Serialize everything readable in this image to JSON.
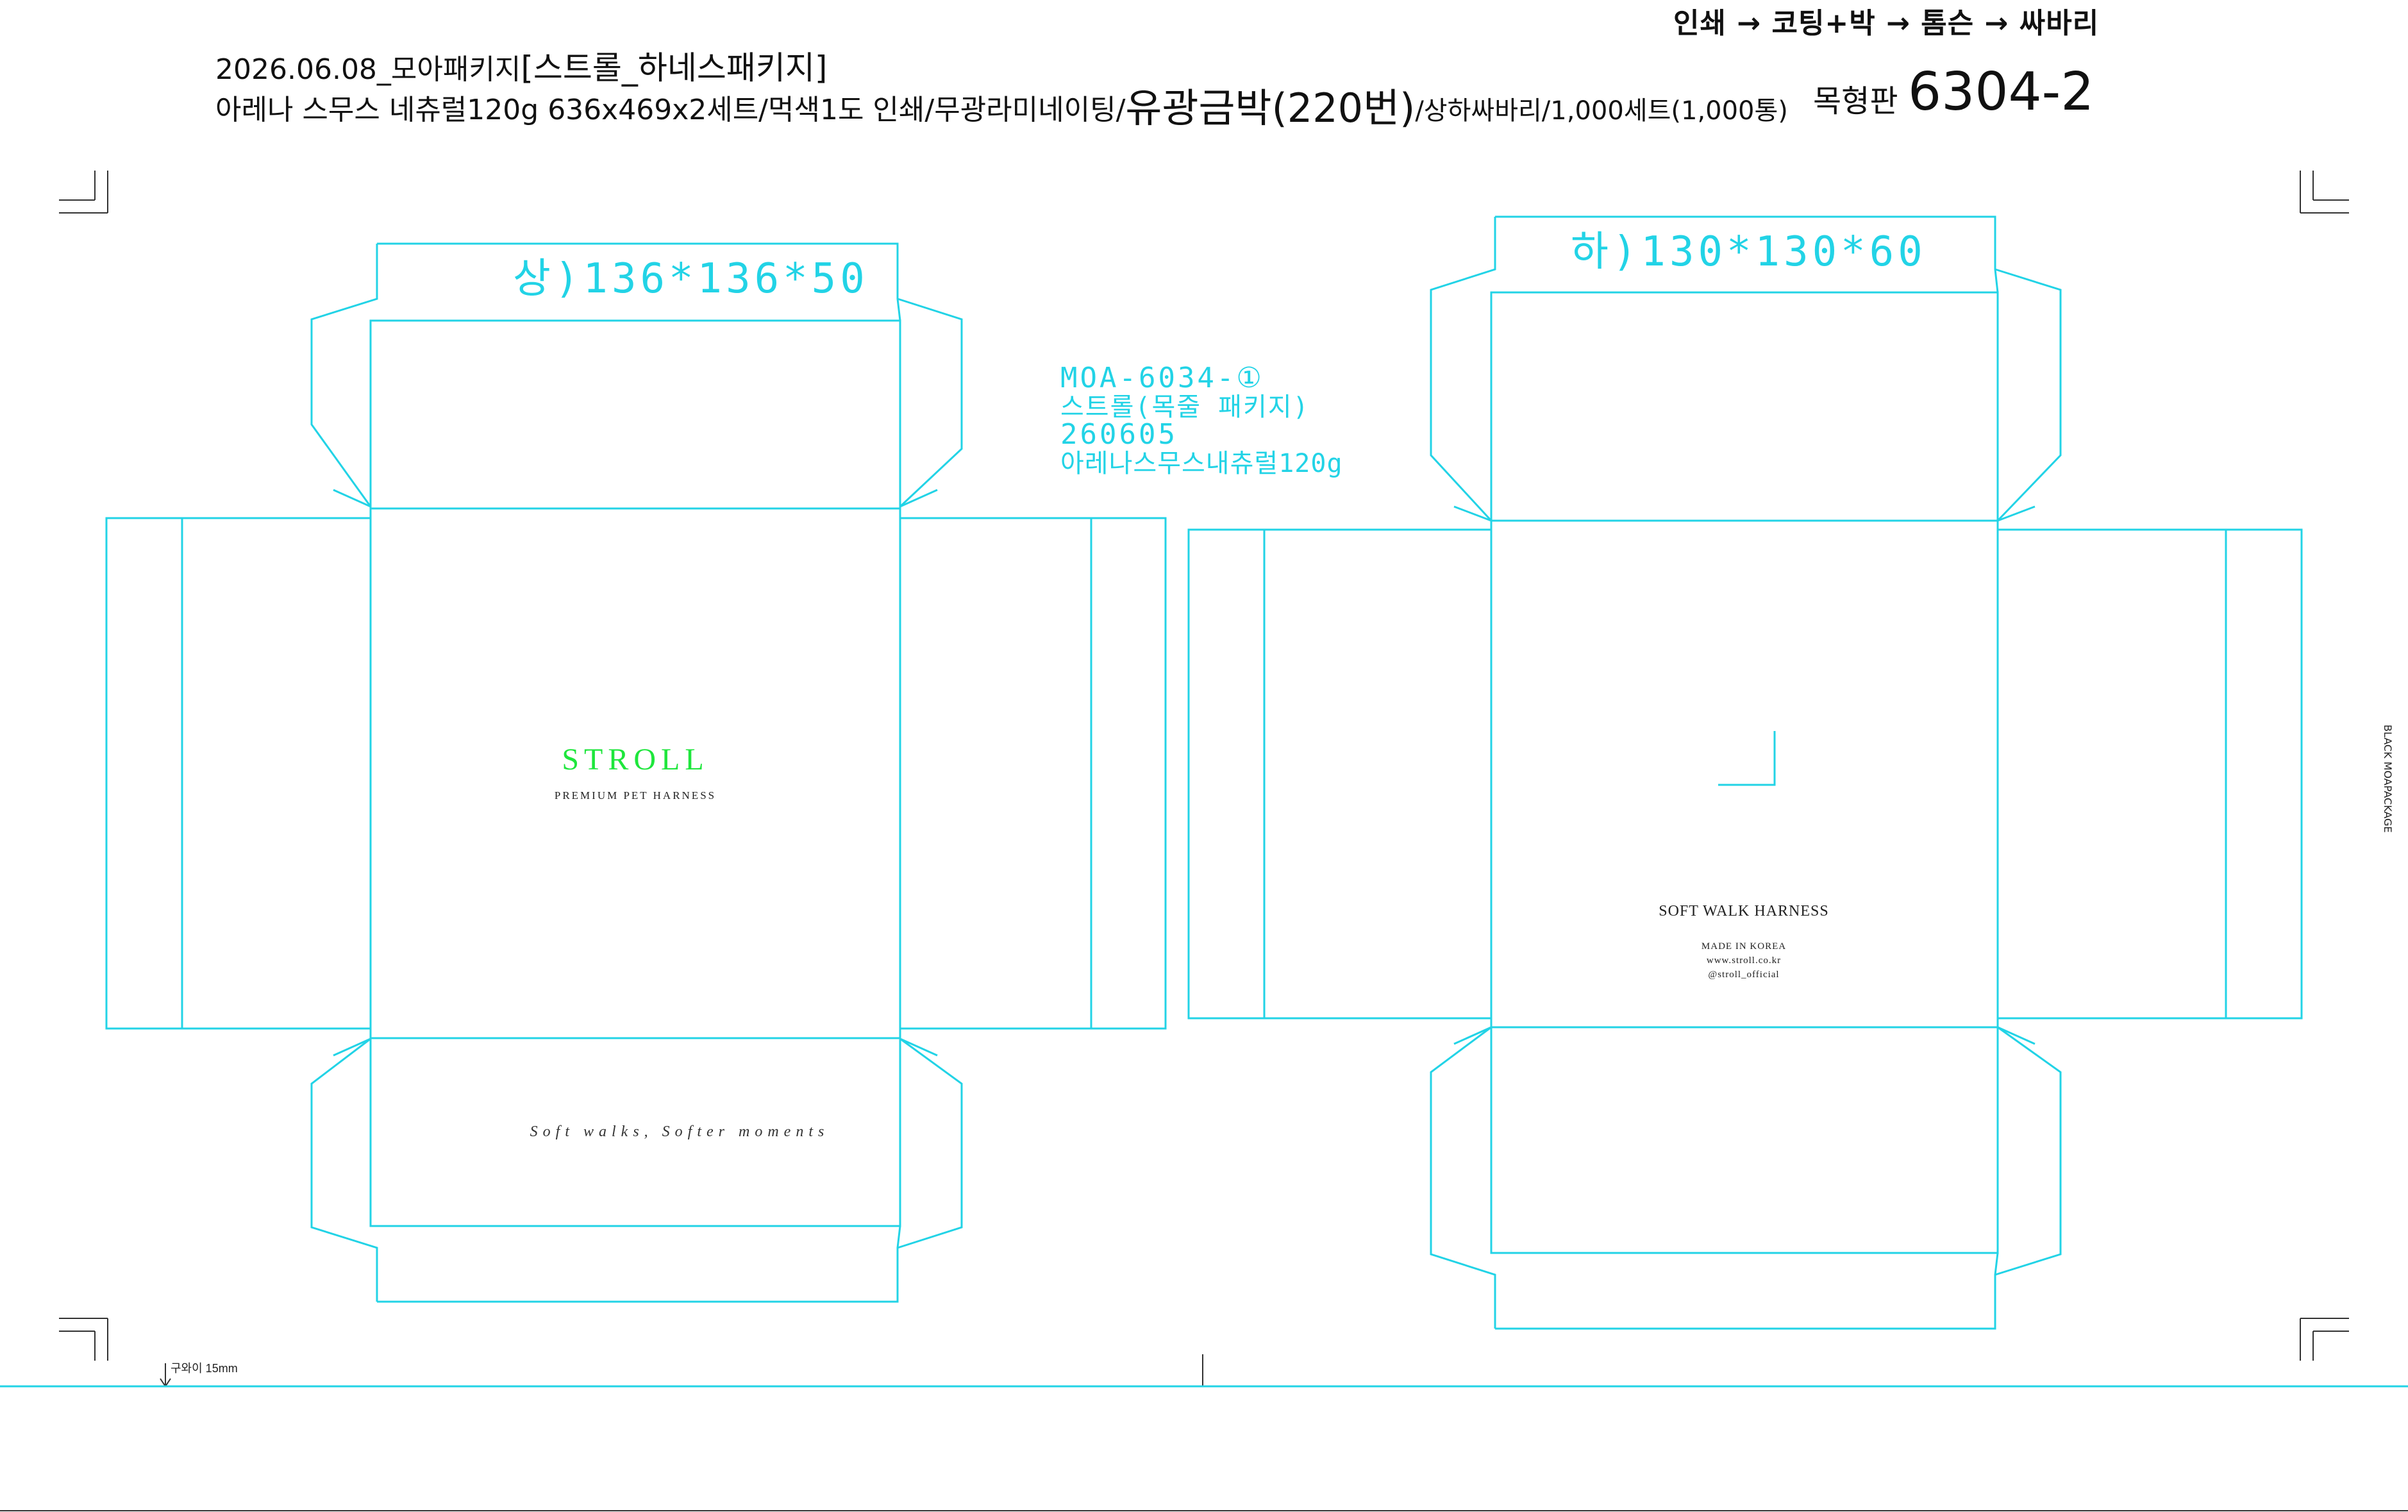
{
  "header": {
    "process_flow": "인쇄 → 코팅+박 → 톰슨 → 싸바리",
    "line1_prefix": "2026.06.08_모아패키지",
    "line1_product": "[스트롤_하네스패키지]",
    "line2_spec": "아레나 스무스 네츄럴120g 636x469x2세트/먹색1도 인쇄/무광라미네이팅/",
    "line2_foil": "유광금박(220번)",
    "line2_finish": "/상하싸바리/1,000세트(1,000통)",
    "mold_label": "목형판",
    "mold_number": "6304-2"
  },
  "dieline": {
    "upper_dims": "상)136*136*50",
    "lower_dims": "하)130*130*60",
    "job_info": [
      "MOA-6034-①",
      "스트롤(목줄 패키지)",
      "260605",
      "아레나스무스내츄럴120g"
    ]
  },
  "lid": {
    "brand": "STROLL",
    "tagline": "PREMIUM PET HARNESS",
    "script_line": "Soft walks, Softer moments",
    "brand_color": "#1ee63c"
  },
  "base": {
    "product_name": "SOFT WALK HARNESS",
    "made_in": "MADE IN KOREA",
    "website": "www.stroll.co.kr",
    "social": "@stroll_official"
  },
  "margins": {
    "side_mark": "BLACK MOAPACKAGE",
    "grip_label": "구와이 15mm"
  },
  "colors": {
    "dieline": "#22d3e6",
    "text": "#111111"
  }
}
